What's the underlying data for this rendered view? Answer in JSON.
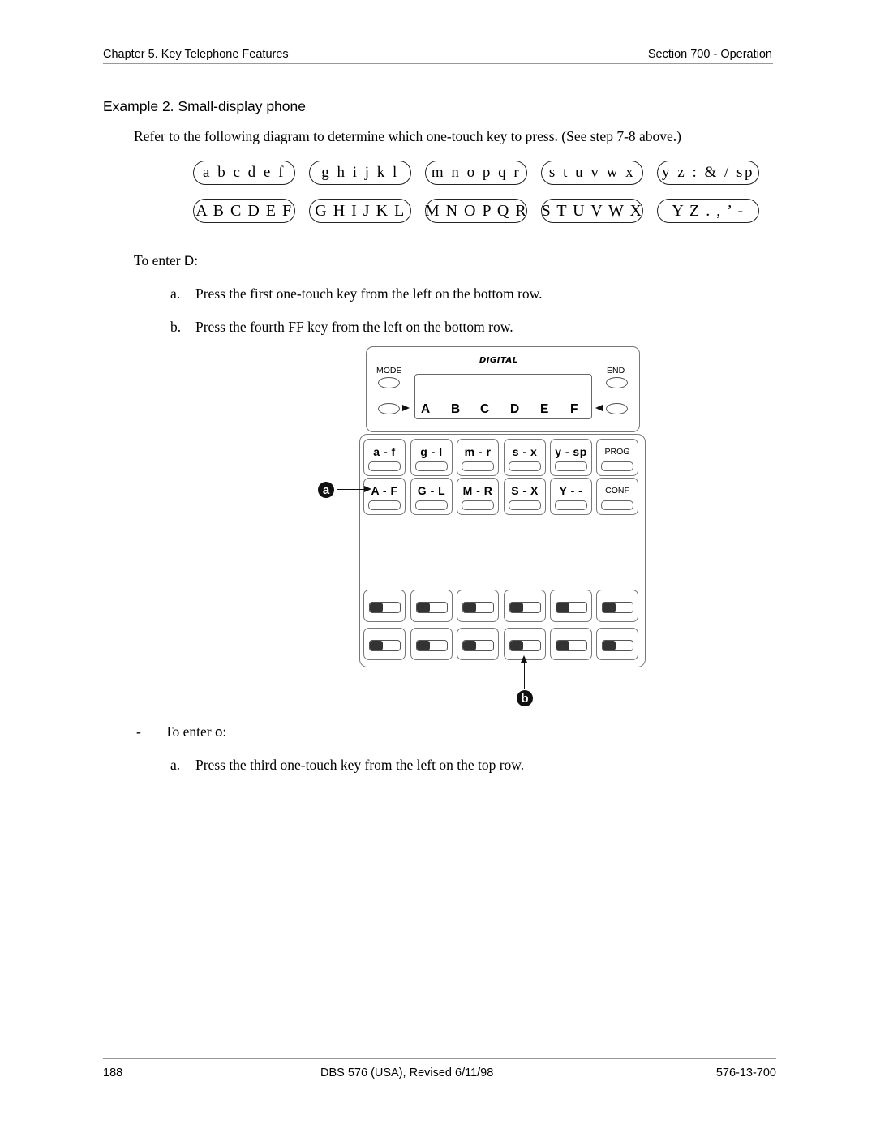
{
  "header": {
    "left": "Chapter 5. Key Telephone Features",
    "right": "Section 700 - Operation"
  },
  "example_title": "Example 2. Small-display phone",
  "intro": "Refer to the following diagram to determine which one-touch key to press. (See step 7-8 above.)",
  "key_map": {
    "lower_row": [
      "a b c d e f",
      "g h i j k l",
      "m n o p q r",
      "s t u v w x",
      "y z : & / sp"
    ],
    "upper_row": [
      "A B C D E F",
      "G H I J K L",
      "M N O P Q R",
      "S T U V W X",
      "Y Z . , ’ -"
    ]
  },
  "example_d": {
    "prefix": "To enter ",
    "char": "D",
    "suffix": ":",
    "steps": [
      {
        "label": "a.",
        "text": "Press the first one-touch key from the left on the bottom row."
      },
      {
        "label": "b.",
        "text": "Press the fourth FF key from the left on the bottom row."
      }
    ]
  },
  "phone": {
    "brand": "DIGITAL",
    "mode_label": "MODE",
    "end_label": "END",
    "lcd_chars": [
      "A",
      "B",
      "C",
      "D",
      "E",
      "F"
    ],
    "one_touch_top": [
      "a - f",
      "g - l",
      "m - r",
      "s - x",
      "y - sp",
      "PROG"
    ],
    "one_touch_bottom": [
      "A - F",
      "G - L",
      "M - R",
      "S - X",
      "Y - -",
      "CONF"
    ],
    "callout_a": "a",
    "callout_b": "b"
  },
  "example_o": {
    "dash": "-",
    "prefix": "To enter ",
    "char": "o",
    "suffix": ":",
    "steps": [
      {
        "label": "a.",
        "text": "Press the third one-touch key from the left on the top row."
      }
    ]
  },
  "footer": {
    "page": "188",
    "center": "DBS 576 (USA), Revised 6/11/98",
    "doc_number": "576-13-700"
  }
}
